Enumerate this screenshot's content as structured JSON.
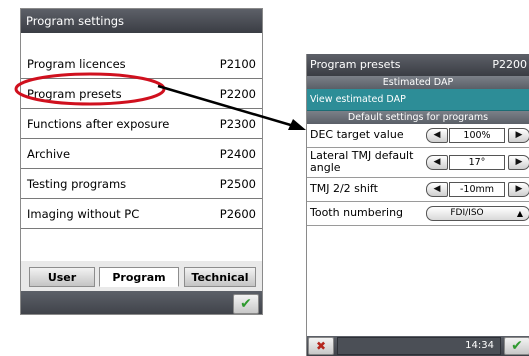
{
  "left": {
    "title": "Program settings",
    "items": [
      {
        "label": "Program licences",
        "code": "P2100"
      },
      {
        "label": "Program presets",
        "code": "P2200"
      },
      {
        "label": "Functions after exposure",
        "code": "P2300"
      },
      {
        "label": "Archive",
        "code": "P2400"
      },
      {
        "label": "Testing programs",
        "code": "P2500"
      },
      {
        "label": "Imaging without PC",
        "code": "P2600"
      }
    ],
    "tabs": [
      "User",
      "Program",
      "Technical"
    ],
    "active_tab": "Program",
    "ok_icon": "check-icon"
  },
  "right": {
    "title": "Program presets",
    "code": "P2200",
    "section1": "Estimated DAP",
    "view_button": "View estimated DAP",
    "section2": "Default settings for programs",
    "settings": [
      {
        "label": "DEC target value",
        "value": "100%"
      },
      {
        "label": "Lateral TMJ default angle",
        "value": "17°"
      },
      {
        "label": "TMJ 2/2 shift",
        "value": "-10mm"
      }
    ],
    "tooth": {
      "label": "Tooth numbering",
      "value": "FDI/ISO"
    },
    "clock": "14:34",
    "cancel_icon": "close-icon",
    "ok_icon": "check-icon"
  },
  "colors": {
    "titlebar": "#3a3d44",
    "teal": "#2d8d97",
    "highlight": "#d0101e",
    "ok": "#2f9a2f",
    "cancel": "#b5261e"
  }
}
